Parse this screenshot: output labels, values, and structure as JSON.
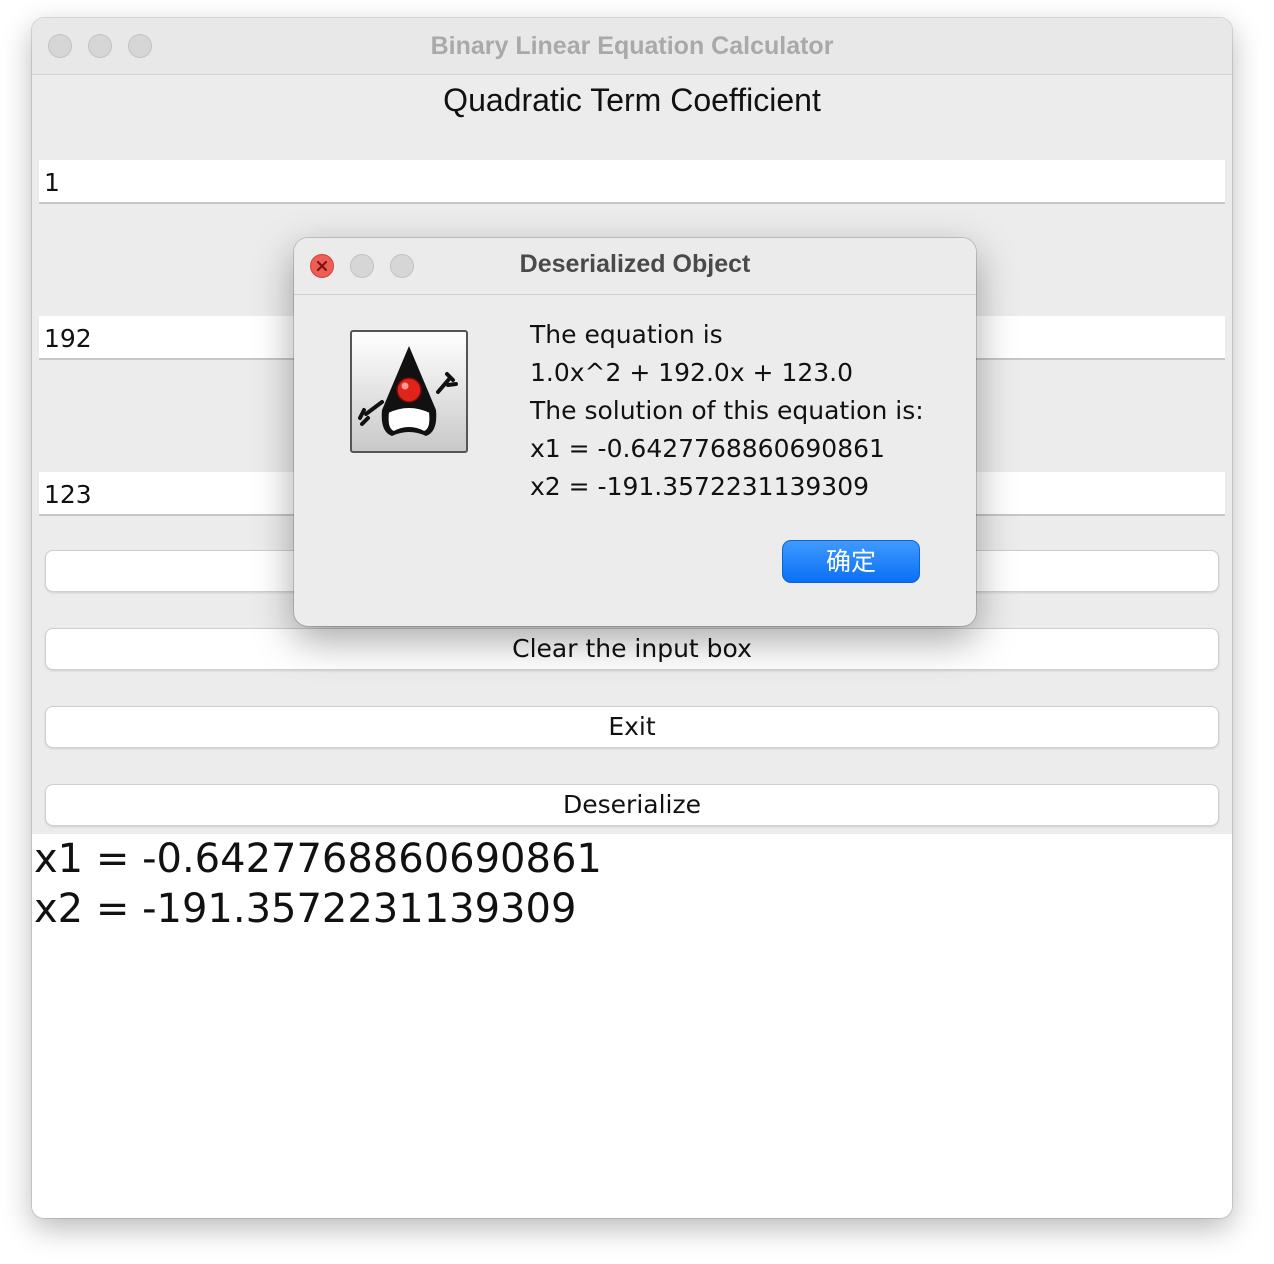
{
  "window": {
    "title": "Binary Linear Equation Calculator"
  },
  "form": {
    "quadratic_label": "Quadratic Term Coefficient",
    "quadratic_value": "1",
    "linear_value": "192",
    "constant_value": "123",
    "clear_button": "Clear the input box",
    "exit_button": "Exit",
    "deserialize_button": "Deserialize"
  },
  "output": {
    "lines": [
      "x1 = -0.6427768860690861",
      "x2 = -191.3572231139309"
    ]
  },
  "dialog": {
    "title": "Deserialized Object",
    "icon": "java-duke-icon",
    "lines": [
      "The equation is",
      "1.0x^2 + 192.0x + 123.0",
      "The solution of this equation is:",
      "x1 = -0.6427768860690861",
      "x2 = -191.3572231139309"
    ],
    "ok_button": "确定",
    "accent_color": "#0a6ff5"
  }
}
